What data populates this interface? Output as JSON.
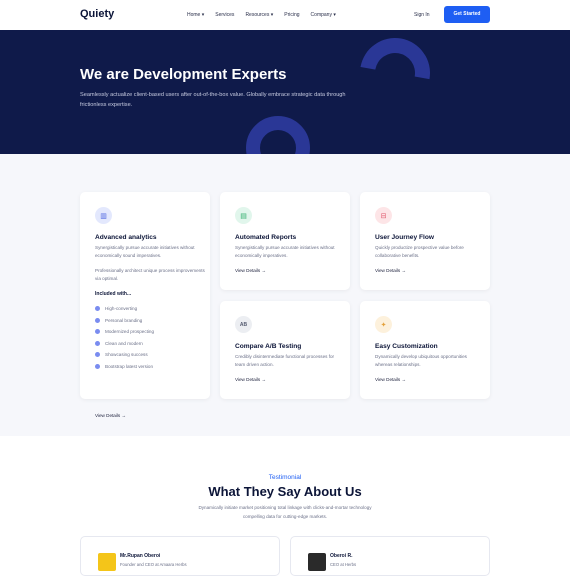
{
  "brand": {
    "logo": "Quiety",
    "accent": "#1e5ef3",
    "hero_bg": "#0f1a4a"
  },
  "nav": {
    "items": [
      "Home ▾",
      "Services",
      "Resources ▾",
      "Pricing",
      "Company ▾"
    ],
    "signin": "Sign In",
    "cta": "Get Started"
  },
  "hero": {
    "title": "We are Development Experts",
    "subtitle": "Seamlessly actualize client-based users after out-of-the-box value. Globally embrace strategic data through frictionless expertise."
  },
  "features": {
    "main": {
      "icon": "chart-icon",
      "title": "Advanced analytics",
      "desc1": "Synergistically pursue accurate initiatives without economically sound imperatives.",
      "desc2": "Professionally architect unique process improvements via optimal.",
      "included_title": "Included with...",
      "included": [
        "High-converting",
        "Personal branding",
        "Modernized prospecting",
        "Clean and modern",
        "Showcasing success",
        "Bootstrap latest version"
      ],
      "link": "View Details →"
    },
    "cards": [
      {
        "icon": "file-icon",
        "title": "Automated Reports",
        "desc": "Synergistically pursue accurate initiatives without economically imperatives.",
        "link": "View Details →"
      },
      {
        "icon": "user-flow-icon",
        "title": "User Journey Flow",
        "desc": "Quickly productize prospective value before collaborative benefits.",
        "link": "View Details →"
      },
      {
        "icon": "ab-test-icon",
        "title": "Compare A/B Testing",
        "desc": "Credibly disintermediate functional processes for team driven action.",
        "link": "View Details →"
      },
      {
        "icon": "customize-icon",
        "title": "Easy Customization",
        "desc": "Dynamically develop ubiquitous opportunities whereas relationships.",
        "link": "View Details →"
      }
    ]
  },
  "testimonial": {
    "label": "Testimonial",
    "title": "What They Say About Us",
    "desc": "Dynamically initiate market positioning total linkage with clicks-and-mortar technology compelling data for cutting-edge markets.",
    "people": [
      {
        "name": "Mr.Rupan Oberoi",
        "role": "Founder and CEO at Amaara Herbs"
      },
      {
        "name": "Oberoi R.",
        "role": "CEO at Herbs"
      }
    ]
  }
}
